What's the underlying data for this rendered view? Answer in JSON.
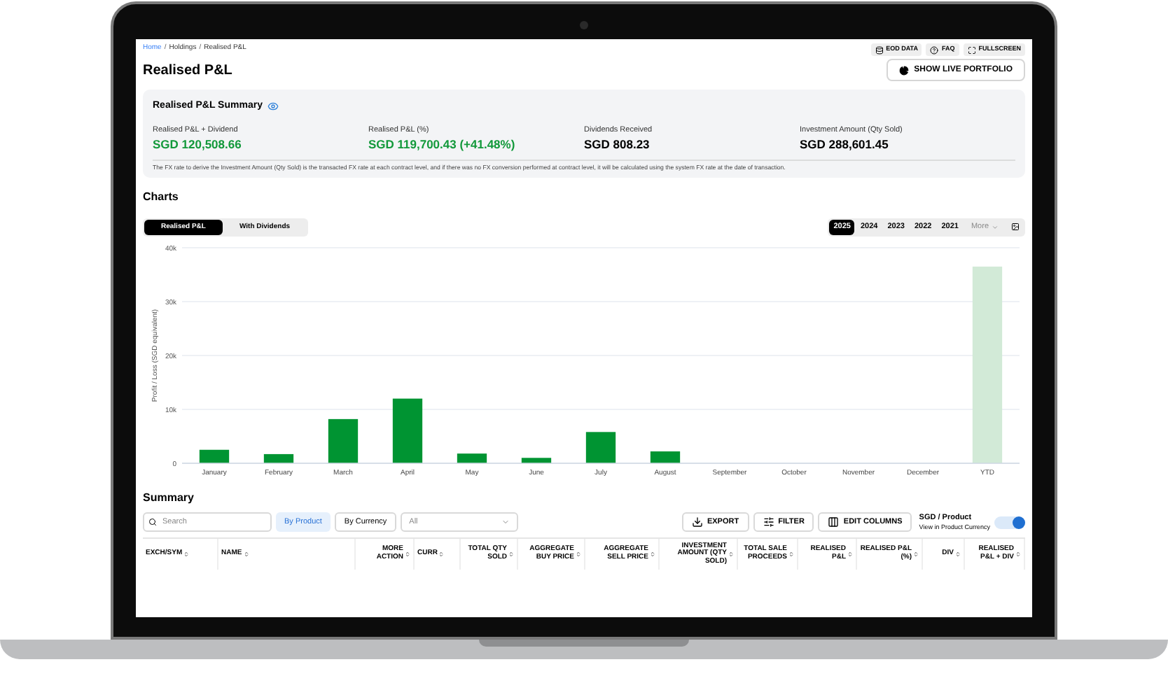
{
  "breadcrumb": {
    "separator": "/",
    "items": [
      {
        "label": "Home",
        "link": true
      },
      {
        "label": "Holdings",
        "link": false
      },
      {
        "label": "Realised P&L",
        "link": false
      }
    ]
  },
  "top_buttons": [
    {
      "label": "EOD DATA",
      "kind": "data"
    },
    {
      "label": "FAQ",
      "kind": "help"
    },
    {
      "label": "FULLSCREEN",
      "kind": "fullscreen"
    }
  ],
  "title": "Realised P&L",
  "live_button": "SHOW LIVE PORTFOLIO",
  "summary": {
    "title": "Realised P&L Summary",
    "metrics": [
      {
        "label": "Realised P&L + Dividend",
        "value": "SGD 120,508.66",
        "positive": true
      },
      {
        "label": "Realised P&L (%)",
        "value": "SGD 119,700.43 (+41.48%)",
        "positive": true
      },
      {
        "label": "Dividends Received",
        "value": "SGD 808.23",
        "positive": false
      },
      {
        "label": "Investment Amount (Qty Sold)",
        "value": "SGD 288,601.45",
        "positive": false
      }
    ],
    "note": "The FX rate to derive the Investment Amount (Qty Sold) is the transacted FX rate at each contract level, and if there was no FX conversion performed at contract level, it will be calculated using the system FX rate at the date of transaction."
  },
  "charts": {
    "title": "Charts",
    "tabs": [
      {
        "label": "Realised P&L",
        "selected": true
      },
      {
        "label": "With Dividends",
        "selected": false
      }
    ],
    "years": [
      {
        "label": "2025",
        "selected": true
      },
      {
        "label": "2024",
        "selected": false
      },
      {
        "label": "2023",
        "selected": false
      },
      {
        "label": "2022",
        "selected": false
      },
      {
        "label": "2021",
        "selected": false
      }
    ],
    "more": "More",
    "chart_data": {
      "type": "bar",
      "grid": true,
      "ylabel": "Profit / Loss (SGD equivalent)",
      "categories": [
        "January",
        "February",
        "March",
        "April",
        "May",
        "June",
        "July",
        "August",
        "September",
        "October",
        "November",
        "December",
        "YTD"
      ],
      "stacked": true,
      "ylim": [
        0,
        40000
      ],
      "yticks": [
        {
          "value": 0,
          "label": "0"
        },
        {
          "value": 10000,
          "label": "10k"
        },
        {
          "value": 20000,
          "label": "20k"
        },
        {
          "value": 30000,
          "label": "30k"
        },
        {
          "value": 40000,
          "label": "40k"
        }
      ],
      "series": [
        {
          "color": "#009432",
          "values": [
            2500,
            1700,
            8200,
            12000,
            1800,
            1000,
            5800,
            2200,
            null,
            null,
            null,
            null,
            null
          ]
        },
        {
          "color": "#d2ead7",
          "values": [
            null,
            null,
            null,
            null,
            null,
            null,
            null,
            null,
            null,
            null,
            null,
            null,
            36500
          ]
        }
      ]
    }
  },
  "table_section": {
    "title": "Summary",
    "search": {
      "placeholder": "Search"
    },
    "group_tabs": [
      {
        "label": "By Product",
        "selected": true
      },
      {
        "label": "By Currency",
        "selected": false
      }
    ],
    "filter_select": {
      "value": "All"
    },
    "actions": [
      {
        "label": "EXPORT",
        "kind": "export"
      },
      {
        "label": "FILTER",
        "kind": "filter"
      },
      {
        "label": "EDIT COLUMNS",
        "kind": "columns"
      }
    ],
    "currency_toggle": {
      "title": "SGD / Product",
      "subtitle": "View in Product Currency",
      "on": true
    },
    "columns": [
      "EXCH/SYM",
      "NAME",
      "MORE ACTION",
      "CURR",
      "TOTAL QTY SOLD",
      "AGGREGATE BUY PRICE",
      "AGGREGATE SELL PRICE",
      "INVESTMENT AMOUNT (QTY SOLD)",
      "TOTAL SALE PROCEEDS",
      "REALISED P&L",
      "REALISED P&L (%)",
      "DIV",
      "REALISED P&L + DIV"
    ]
  }
}
